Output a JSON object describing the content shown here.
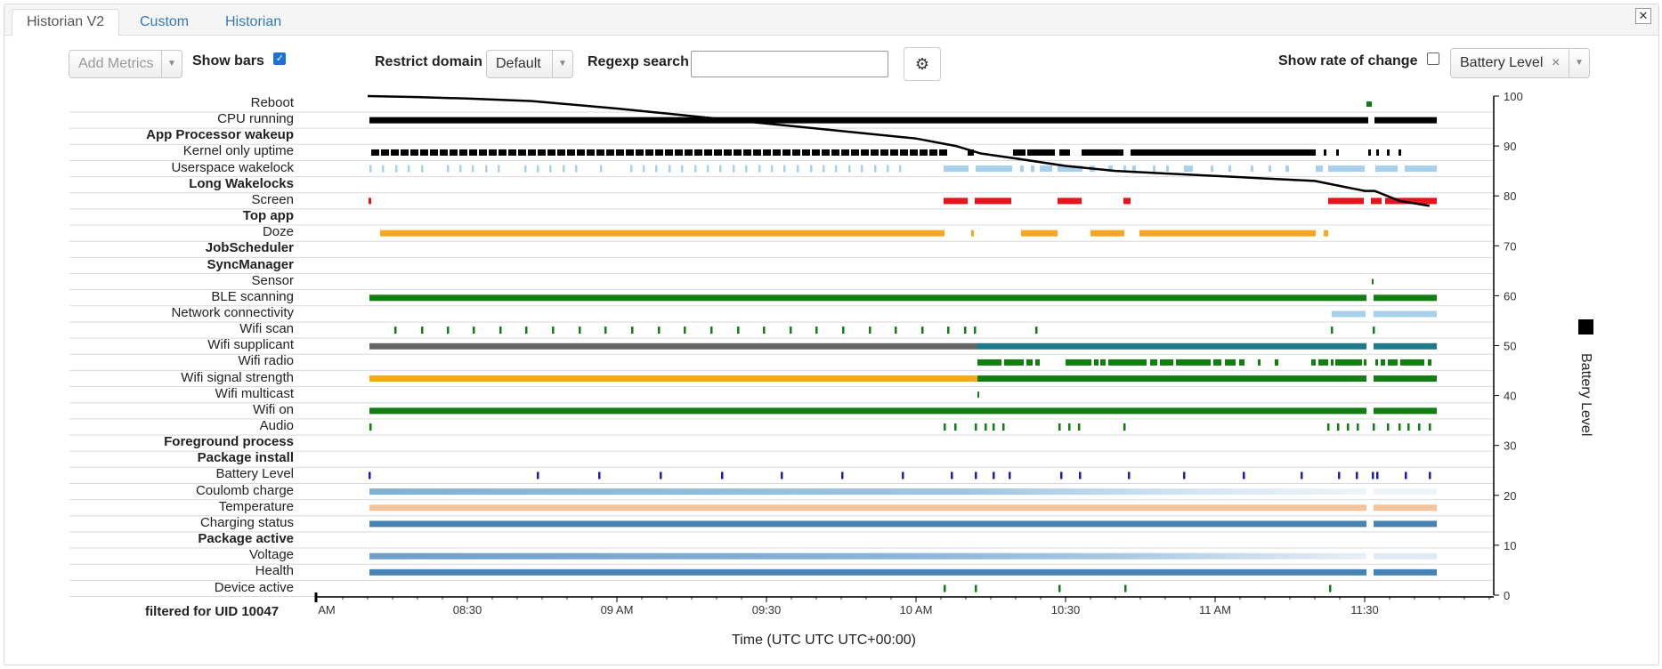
{
  "tabs": [
    {
      "label": "Historian V2",
      "active": true
    },
    {
      "label": "Custom",
      "active": false
    },
    {
      "label": "Historian",
      "active": false
    }
  ],
  "close_label": "✕",
  "toolbar": {
    "add_metrics_placeholder": "Add Metrics",
    "show_bars_label": "Show bars",
    "show_bars_checked": true,
    "restrict_domain_label": "Restrict domain",
    "restrict_domain_value": "Default",
    "regexp_label": "Regexp search",
    "regexp_value": "",
    "show_roc_label": "Show rate of change",
    "show_roc_checked": false,
    "metric_selected": "Battery Level",
    "metric_remove": "×"
  },
  "rows": [
    {
      "label": "Reboot",
      "header": false
    },
    {
      "label": "CPU running",
      "header": false
    },
    {
      "label": "App Processor wakeup",
      "header": true
    },
    {
      "label": "Kernel only uptime",
      "header": false
    },
    {
      "label": "Userspace wakelock",
      "header": false
    },
    {
      "label": "Long Wakelocks",
      "header": true
    },
    {
      "label": "Screen",
      "header": false
    },
    {
      "label": "Top app",
      "header": true
    },
    {
      "label": "Doze",
      "header": false
    },
    {
      "label": "JobScheduler",
      "header": true
    },
    {
      "label": "SyncManager",
      "header": true
    },
    {
      "label": "Sensor",
      "header": false
    },
    {
      "label": "BLE scanning",
      "header": false
    },
    {
      "label": "Network connectivity",
      "header": false
    },
    {
      "label": "Wifi scan",
      "header": false
    },
    {
      "label": "Wifi supplicant",
      "header": false
    },
    {
      "label": "Wifi radio",
      "header": false
    },
    {
      "label": "Wifi signal strength",
      "header": false
    },
    {
      "label": "Wifi multicast",
      "header": false
    },
    {
      "label": "Wifi on",
      "header": false
    },
    {
      "label": "Audio",
      "header": false
    },
    {
      "label": "Foreground process",
      "header": true
    },
    {
      "label": "Package install",
      "header": true
    },
    {
      "label": "Battery Level",
      "header": false
    },
    {
      "label": "Coulomb charge",
      "header": false
    },
    {
      "label": "Temperature",
      "header": false
    },
    {
      "label": "Charging status",
      "header": false
    },
    {
      "label": "Package active",
      "header": true
    },
    {
      "label": "Voltage",
      "header": false
    },
    {
      "label": "Health",
      "header": false
    },
    {
      "label": "Device active",
      "header": false
    }
  ],
  "footer_label": "filtered for UID 10047",
  "x_axis_title": "Time (UTC UTC UTC+00:00)",
  "y_axis_title": "Battery Level",
  "colors": {
    "black": "#000000",
    "green": "#137d13",
    "light_blue": "#a6d0ec",
    "red": "#e8141c",
    "orange": "#f5a623",
    "gray": "#666666",
    "teal": "#1b7b8c",
    "steel_blue": "#4682b4",
    "peach": "#f4c29b",
    "navy": "#1c1cae"
  },
  "chart_data": {
    "type": "line",
    "x_ticks": [
      "AM",
      "08:30",
      "09 AM",
      "09:30",
      "10 AM",
      "10:30",
      "11 AM",
      "11:30"
    ],
    "x_minutes": [
      0,
      30,
      60,
      90,
      120,
      150,
      180,
      210
    ],
    "ylim": [
      0,
      100
    ],
    "y_ticks": [
      0,
      10,
      20,
      30,
      40,
      50,
      60,
      70,
      80,
      90,
      100
    ],
    "ylabel": "Battery Level",
    "xlabel": "Time (UTC UTC UTC+00:00)",
    "series": [
      {
        "name": "Battery Level",
        "x_minutes": [
          10,
          20,
          30,
          43,
          60,
          75,
          90,
          105,
          120,
          128,
          133,
          140,
          150,
          160,
          170,
          180,
          190,
          200,
          205,
          210,
          212,
          217,
          223
        ],
        "values": [
          100,
          99.8,
          99.5,
          99,
          97.5,
          96,
          94.5,
          93,
          91.5,
          90,
          88.5,
          87.5,
          86,
          85,
          84.5,
          84,
          83.5,
          83,
          82,
          81,
          81,
          79,
          78
        ]
      }
    ]
  }
}
